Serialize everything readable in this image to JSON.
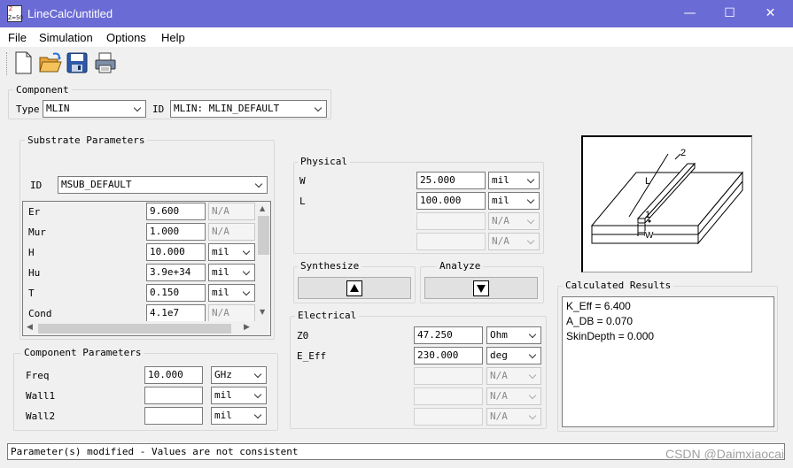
{
  "window": {
    "title": "LineCalc/untitled",
    "icon_top": "Z",
    "icon_bottom": "Z=50",
    "accent": "#6b6bd6"
  },
  "menu": [
    "File",
    "Simulation",
    "Options",
    "Help"
  ],
  "toolbar": [
    "new-file-icon",
    "open-folder-icon",
    "save-disk-icon",
    "print-icon"
  ],
  "component": {
    "title": "Component",
    "type_label": "Type",
    "type_value": "MLIN",
    "id_label": "ID",
    "id_value": "MLIN: MLIN_DEFAULT"
  },
  "substrate": {
    "title": "Substrate Parameters",
    "id_label": "ID",
    "id_value": "MSUB_DEFAULT",
    "rows": [
      {
        "name": "Er",
        "value": "9.600",
        "unit": "N/A"
      },
      {
        "name": "Mur",
        "value": "1.000",
        "unit": "N/A"
      },
      {
        "name": "H",
        "value": "10.000",
        "unit": "mil"
      },
      {
        "name": "Hu",
        "value": "3.9e+34",
        "unit": "mil"
      },
      {
        "name": "T",
        "value": "0.150",
        "unit": "mil"
      },
      {
        "name": "Cond",
        "value": "4.1e7",
        "unit": "N/A"
      }
    ]
  },
  "component_params": {
    "title": "Component Parameters",
    "rows": [
      {
        "name": "Freq",
        "value": "10.000",
        "unit": "GHz"
      },
      {
        "name": "Wall1",
        "value": "",
        "unit": "mil"
      },
      {
        "name": "Wall2",
        "value": "",
        "unit": "mil"
      }
    ]
  },
  "physical": {
    "title": "Physical",
    "rows": [
      {
        "name": "W",
        "value": "25.000",
        "unit": "mil"
      },
      {
        "name": "L",
        "value": "100.000",
        "unit": "mil"
      },
      {
        "name": "",
        "value": "",
        "unit": "N/A"
      },
      {
        "name": "",
        "value": "",
        "unit": "N/A"
      }
    ]
  },
  "synthesize": {
    "label": "Synthesize"
  },
  "analyze": {
    "label": "Analyze"
  },
  "electrical": {
    "title": "Electrical",
    "rows": [
      {
        "name": "Z0",
        "value": "47.250",
        "unit": "Ohm"
      },
      {
        "name": "E_Eff",
        "value": "230.000",
        "unit": "deg"
      },
      {
        "name": "",
        "value": "",
        "unit": "N/A"
      },
      {
        "name": "",
        "value": "",
        "unit": "N/A"
      }
    ]
  },
  "diagram": {
    "port1": "1",
    "port2": "2",
    "length": "L",
    "width": "W"
  },
  "results": {
    "title": "Calculated Results",
    "lines": [
      "K_Eff = 6.400",
      "A_DB = 0.070",
      "SkinDepth = 0.000"
    ]
  },
  "status": "Parameter(s) modified - Values are not consistent",
  "watermark": "CSDN @Daimxiaocai"
}
